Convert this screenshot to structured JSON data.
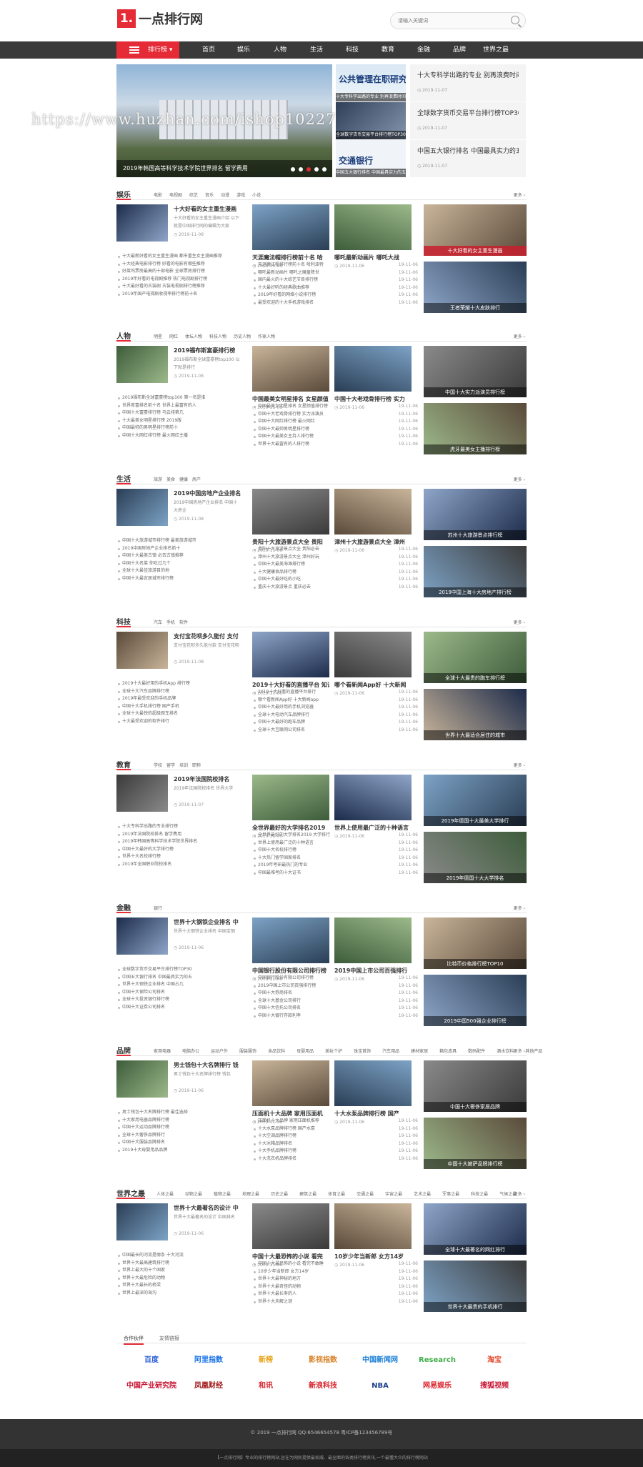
{
  "site": {
    "logo_mark": "1.",
    "logo_text": "一点排行网",
    "search_placeholder": "请输入关键词"
  },
  "nav": {
    "category": "排行榜",
    "items": [
      "首页",
      "娱乐",
      "人物",
      "生活",
      "科技",
      "教育",
      "金融",
      "品牌",
      "世界之最"
    ]
  },
  "watermark": "https://www.huzhan.com/ishop10227",
  "hero": {
    "caption": "2019年韩国高等科学技术学院世界排名 留学费用"
  },
  "side_images": [
    {
      "big": "公共管理在职研究生",
      "caption": "十大专科学出路的专业 别再浪费时间"
    },
    {
      "caption": "全球数字货币交易平台排行榜TOP30"
    },
    {
      "big": "交通银行",
      "caption": "中国五大银行排名 中国最具实力的五"
    }
  ],
  "side_news": [
    {
      "title": "十大专科学出路的专业 别再浪费时间",
      "date": "2019-11-07"
    },
    {
      "title": "全球数字货币交易平台排行榜TOP30",
      "date": "2019-11-07"
    },
    {
      "title": "中国五大银行排名 中国最具实力的五",
      "date": "2019-11-07"
    }
  ],
  "more": "更多",
  "sections": [
    {
      "title": "娱乐",
      "tabs": [
        "电影",
        "电视剧",
        "综艺",
        "音乐",
        "动漫",
        "游戏",
        "小说"
      ],
      "lead": {
        "title": "十大好看的女主重生漫画",
        "summary": "十大好看的女主重生漫画介绍 以下就是中国排行网的编辑为大家",
        "date": "2019-11-08"
      },
      "list": [
        "十大最新好看的女主重生漫画 都市重生女主漫画推荐",
        "十大经典电影排行榜 好看的电影有哪些推荐",
        "好莱坞票房最高的十部电影 全球票房排行榜",
        "2019年好看的电视剧推荐 热门电视剧排行榜",
        "十大最好看的古装剧 古装电视剧排行榜推荐",
        "2019年国产电视剧收视率排行榜前十名"
      ],
      "cards": [
        {
          "title": "天涯魔法帽排行榜前十名 哈",
          "date": "2019-11-06"
        },
        {
          "title": "哪吒最新动画片 哪吒大战",
          "date": "2019-11-06"
        }
      ],
      "clist": [
        {
          "t": "天涯魔法帽排行榜前十名 哈利波特",
          "d": "19-11-06"
        },
        {
          "t": "哪吒最新动画片 哪吒之魔童降世",
          "d": "19-11-06"
        },
        {
          "t": "国内最火的十大综艺节目排行榜",
          "d": "19-11-06"
        },
        {
          "t": "十大最好听的经典歌曲推荐",
          "d": "19-11-06"
        },
        {
          "t": "2019年好看的网络小说排行榜",
          "d": "19-11-06"
        },
        {
          "t": "最受欢迎的十大手机游戏排名",
          "d": "19-11-06"
        }
      ],
      "right": [
        {
          "caption": "十大好看的女主重生漫画"
        },
        {
          "caption": "王者荣耀十大皮肤排行"
        }
      ]
    },
    {
      "title": "人物",
      "tabs": [
        "明星",
        "网红",
        "体坛人物",
        "科技人物",
        "历史人物",
        "作家人物"
      ],
      "lead": {
        "title": "2019福布斯富豪排行榜",
        "summary": "2019福布斯全球富豪榜top100 以下就是排行",
        "date": "2019-11-08"
      },
      "list": [
        "2019福布斯全球富豪榜top100 第一名是谁",
        "世界首富排名前十名 世界上最富有的人",
        "中国十大富豪排行榜 马云排第几",
        "十大最美女明星排行榜 2019版",
        "中国最帅的男明星排行榜前十",
        "中国十大网红排行榜 最火网红主播"
      ],
      "cards": [
        {
          "title": "中国最美女明星排名 女星颜值",
          "date": "2019-11-06"
        },
        {
          "title": "中国十大老戏骨排行榜 实力",
          "date": "2019-11-06"
        }
      ],
      "clist": [
        {
          "t": "中国最美女明星排名 女星颜值排行榜",
          "d": "19-11-06"
        },
        {
          "t": "中国十大老戏骨排行榜 实力派演员",
          "d": "19-11-06"
        },
        {
          "t": "中国十大网红排行榜 最火网红",
          "d": "19-11-06"
        },
        {
          "t": "中国十大最帅男明星排行榜",
          "d": "19-11-06"
        },
        {
          "t": "中国十大最美女主持人排行榜",
          "d": "19-11-06"
        },
        {
          "t": "世界十大最富有的人排行榜",
          "d": "19-11-06"
        }
      ],
      "right": [
        {
          "caption": "中国十大实力派演员排行榜"
        },
        {
          "caption": "虎牙最美女主播排行榜"
        }
      ]
    },
    {
      "title": "生活",
      "tabs": [
        "旅游",
        "美食",
        "健康",
        "房产"
      ],
      "lead": {
        "title": "2019中国房地产企业排名",
        "summary": "2019中国房地产企业排名 中国十大房企",
        "date": "2019-11-08"
      },
      "list": [
        "中国十大旅游城市排行榜 最美旅游城市",
        "2019中国房地产企业排名前十",
        "中国十大最美古镇 必去古镇推荐",
        "中国十大名菜 你吃过几个",
        "全球十大最佳旅游目的地",
        "中国十大最宜居城市排行榜"
      ],
      "cards": [
        {
          "title": "贵阳十大旅游景点大全 贵阳",
          "date": "2019-11-06"
        },
        {
          "title": "漳州十大旅游景点大全 漳州",
          "date": "2019-11-06"
        }
      ],
      "clist": [
        {
          "t": "贵阳十大旅游景点大全 贵阳必去",
          "d": "19-11-06"
        },
        {
          "t": "漳州十大旅游景点大全 漳州好玩",
          "d": "19-11-06"
        },
        {
          "t": "中国十大最美海滩排行榜",
          "d": "19-11-06"
        },
        {
          "t": "十大健康食品排行榜",
          "d": "19-11-06"
        },
        {
          "t": "中国十大最好吃的小吃",
          "d": "19-11-06"
        },
        {
          "t": "重庆十大旅游景点 重庆必去",
          "d": "19-11-06"
        }
      ],
      "right": [
        {
          "caption": "苏州十大旅游景点排行榜"
        },
        {
          "caption": "2019中国上海十大房地产排行榜"
        }
      ]
    },
    {
      "title": "科技",
      "tabs": [
        "汽车",
        "手机",
        "软件"
      ],
      "lead": {
        "title": "支付宝花呗多久能付 支付",
        "summary": "支付宝花呗多久能付款 支付宝花呗",
        "date": "2019-11-08"
      },
      "list": [
        "2019十大最好用的手机App 排行榜",
        "全球十大汽车品牌排行榜",
        "2019年最受欢迎的手机品牌",
        "中国十大手机排行榜 国产手机",
        "全球十大最快的超级跑车排名",
        "十大最受欢迎的软件排行"
      ],
      "cards": [
        {
          "title": "2019十大好看的直播平台 知识",
          "date": "2019-11-06"
        },
        {
          "title": "哪个看新闻App好 十大新闻",
          "date": "2019-11-06"
        }
      ],
      "clist": [
        {
          "t": "2019十大好看的直播平台排行",
          "d": "19-11-06"
        },
        {
          "t": "哪个看新闻App好 十大新闻app",
          "d": "19-11-06"
        },
        {
          "t": "中国十大最好用的手机浏览器",
          "d": "19-11-06"
        },
        {
          "t": "全球十大电动汽车品牌排行",
          "d": "19-11-06"
        },
        {
          "t": "中国十大最好的跑车品牌",
          "d": "19-11-06"
        },
        {
          "t": "全球十大互联网公司排名",
          "d": "19-11-06"
        }
      ],
      "right": [
        {
          "caption": "全球十大最贵的跑车排行榜"
        },
        {
          "caption": "世界十大最适合居住的城市"
        }
      ]
    },
    {
      "title": "教育",
      "tabs": [
        "学校",
        "留学",
        "培训",
        "职称"
      ],
      "lead": {
        "title": "2019年法国院校排名",
        "summary": "2019年法国院校排名 世界大学",
        "date": "2019-11-07"
      },
      "list": [
        "十大专科学出路的专业排行榜",
        "2019年法国院校排名 留学费用",
        "2019年韩国高等科学技术学院世界排名",
        "中国十大最好的大学排行榜",
        "世界十大名校排行榜",
        "2019年全国职业院校排名"
      ],
      "cards": [
        {
          "title": "全世界最好的大学排名2019",
          "date": "2019-11-06"
        },
        {
          "title": "世界上使用最广泛的十种语言",
          "date": "2019-11-06"
        }
      ],
      "clist": [
        {
          "t": "全世界最好的大学排名2019 大学排行",
          "d": "19-11-06"
        },
        {
          "t": "世界上使用最广泛的十种语言",
          "d": "19-11-06"
        },
        {
          "t": "中国十大名校排行榜",
          "d": "19-11-06"
        },
        {
          "t": "十大热门留学国家排名",
          "d": "19-11-06"
        },
        {
          "t": "2019年考研最热门的专业",
          "d": "19-11-06"
        },
        {
          "t": "中国最难考的十大证书",
          "d": "19-11-06"
        }
      ],
      "right": [
        {
          "caption": "2019年德国十大最美大学排行"
        },
        {
          "caption": "2019年德国十大大学排名"
        }
      ]
    },
    {
      "title": "金融",
      "tabs": [
        "银行"
      ],
      "lead": {
        "title": "世界十大钢铁企业排名 中",
        "summary": "世界十大钢铁企业排名 中国宝钢",
        "date": "2019-11-06"
      },
      "list": [
        "全球数字货币交易平台排行榜TOP30",
        "中国五大银行排名 中国最具实力的五",
        "世界十大钢铁企业排名 中国占几",
        "中国十大保险公司排名",
        "全球十大投资银行排行榜",
        "中国十大证券公司排名"
      ],
      "cards": [
        {
          "title": "中国银行股份有限公司排行榜",
          "date": "2019-11-06"
        },
        {
          "title": "2019中国上市公司百强排行",
          "date": "2019-11-06"
        }
      ],
      "clist": [
        {
          "t": "中国银行股份有限公司排行榜",
          "d": "19-11-06"
        },
        {
          "t": "2019中国上市公司百强排行榜",
          "d": "19-11-06"
        },
        {
          "t": "中国十大券商排名",
          "d": "19-11-06"
        },
        {
          "t": "全球十大基金公司排行",
          "d": "19-11-06"
        },
        {
          "t": "中国十大信托公司排名",
          "d": "19-11-06"
        },
        {
          "t": "中国十大银行存款利率",
          "d": "19-11-06"
        }
      ],
      "right": [
        {
          "caption": "比特币价格排行榜TOP10"
        },
        {
          "caption": "2019中国500强企业排行榜"
        }
      ]
    },
    {
      "title": "品牌",
      "tabs": [
        "家用电器",
        "电脑办公",
        "运动户外",
        "服装服饰",
        "食品饮料",
        "母婴用品",
        "美妆个护",
        "珠宝首饰",
        "汽车用品",
        "建材家居",
        "箱包皮具",
        "数码配件",
        "酒水饮料",
        "其他产品"
      ],
      "lead": {
        "title": "男士钱包十大名牌排行 钱",
        "summary": "男士钱包十大名牌排行榜 钱包",
        "date": "2019-11-06"
      },
      "list": [
        "男士钱包十大名牌排行榜 最佳选择",
        "十大家用电器品牌排行榜",
        "中国十大运动品牌排行榜",
        "全球十大奢侈品牌排行",
        "中国十大服装品牌排名",
        "2019十大母婴用品品牌"
      ],
      "cards": [
        {
          "title": "压面机十大品牌 家用压面机",
          "date": "2019-11-06"
        },
        {
          "title": "十大水泵品牌排行榜 国产",
          "date": "2019-11-06"
        }
      ],
      "clist": [
        {
          "t": "压面机十大品牌 家用压面机推荐",
          "d": "19-11-06"
        },
        {
          "t": "十大水泵品牌排行榜 国产水泵",
          "d": "19-11-06"
        },
        {
          "t": "十大空调品牌排行榜",
          "d": "19-11-06"
        },
        {
          "t": "十大冰箱品牌排名",
          "d": "19-11-06"
        },
        {
          "t": "十大手机品牌排行榜",
          "d": "19-11-06"
        },
        {
          "t": "十大洗衣机品牌排名",
          "d": "19-11-06"
        }
      ],
      "right": [
        {
          "caption": "中国十大奢侈家居品牌"
        },
        {
          "caption": "中国十大披萨品牌排行榜"
        }
      ]
    },
    {
      "title": "世界之最",
      "tabs": [
        "人体之最",
        "动物之最",
        "植物之最",
        "地理之最",
        "历史之最",
        "建筑之最",
        "体育之最",
        "交通之最",
        "宇宙之最",
        "艺术之最",
        "军事之最",
        "科技之最",
        "气候之最"
      ],
      "lead": {
        "title": "世界十大最著名的设计 中",
        "summary": "世界十大最著名的设计 中国排名",
        "date": "2019-11-06"
      },
      "list": [
        "中国最长的河流是哪条 十大河流",
        "世界十大最高建筑排行榜",
        "世界上最大的十个国家",
        "世界十大最危险的动物",
        "世界十大最长的桥梁",
        "世界上最深的海沟"
      ],
      "cards": [
        {
          "title": "中国十大最恐怖的小说 看完",
          "date": "2019-11-06"
        },
        {
          "title": "10岁少年当新郎 女方14岁",
          "date": "2019-11-06"
        }
      ],
      "clist": [
        {
          "t": "中国十大最恐怖的小说 看完不敢睡",
          "d": "19-11-06"
        },
        {
          "t": "10岁少年当新郎 女方14岁",
          "d": "19-11-06"
        },
        {
          "t": "世界十大最神秘的地方",
          "d": "19-11-06"
        },
        {
          "t": "世界十大最奇怪的动物",
          "d": "19-11-06"
        },
        {
          "t": "世界十大最长寿的人",
          "d": "19-11-06"
        },
        {
          "t": "世界十大未解之谜",
          "d": "19-11-06"
        }
      ],
      "right": [
        {
          "caption": "全球十大最著名的网红排行"
        },
        {
          "caption": "世界十大最贵的手机排行"
        }
      ]
    }
  ],
  "partners": {
    "tabs": [
      "合作伙伴",
      "友情链接"
    ],
    "logos": [
      "百度",
      "阿里指数",
      "新榜",
      "影视指数",
      "中国新闻网",
      "Research",
      "淘宝",
      "中国产业研究院",
      "凤凰财经",
      "和讯",
      "新浪科技",
      "NBA",
      "网易娱乐",
      "搜狐视频"
    ],
    "colors": [
      "#2b5fd9",
      "#1a73e8",
      "#e8a317",
      "#d9832b",
      "#1a7fd6",
      "#3fae49",
      "#e44a2c",
      "#c8102e",
      "#a01818",
      "#d9232b",
      "#d9232b",
      "#1d3f8f",
      "#d9232b",
      "#c8102e"
    ]
  },
  "footer": {
    "copyright": "© 2019 一点排行网 QQ:6546654578 粤ICP备123456789号",
    "desc": "【一点排行网】专业的排行榜网站,旨在为网民提供最权威、最全面的各类排行榜资讯,一个最懂大众的排行榜网站"
  }
}
